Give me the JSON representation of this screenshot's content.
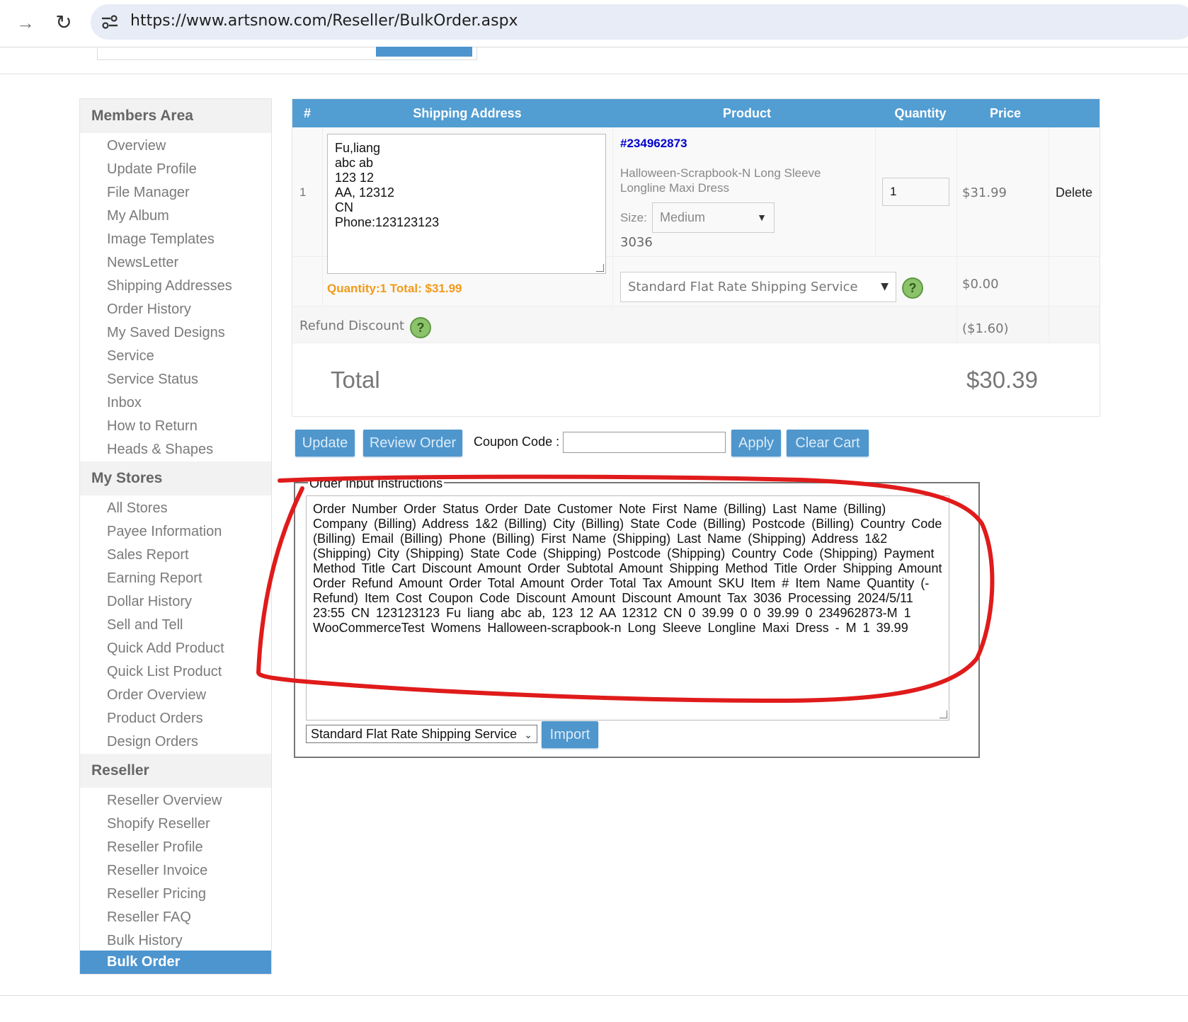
{
  "browser": {
    "url": "https://www.artsnow.com/Reseller/BulkOrder.aspx"
  },
  "sidebar": {
    "sections": [
      {
        "title": "Members Area",
        "items": [
          "Overview",
          "Update Profile",
          "File Manager",
          "My Album",
          "Image Templates",
          "NewsLetter",
          "Shipping Addresses",
          "Order History",
          "My Saved Designs",
          "Service",
          "Service Status",
          "Inbox",
          "How to Return",
          "Heads & Shapes"
        ]
      },
      {
        "title": "My Stores",
        "items": [
          "All Stores",
          "Payee Information",
          "Sales Report",
          "Earning Report",
          "Dollar History",
          "Sell and Tell",
          "Quick Add Product",
          "Quick List Product",
          "Order Overview",
          "Product Orders",
          "Design Orders"
        ]
      },
      {
        "title": "Reseller",
        "items": [
          "Reseller Overview",
          "Shopify Reseller",
          "Reseller Profile",
          "Reseller Invoice",
          "Reseller Pricing",
          "Reseller FAQ",
          "Bulk History",
          "Bulk Order"
        ]
      }
    ],
    "active_item": "Bulk Order"
  },
  "cart": {
    "headers": {
      "index": "#",
      "shipping_address": "Shipping Address",
      "product": "Product",
      "quantity": "Quantity",
      "price": "Price"
    },
    "row": {
      "index": "1",
      "address": "Fu,liang\nabc ab\n123 12\nAA, 12312\nCN\nPhone:123123123",
      "summary": "Quantity:1  Total: $31.99",
      "sku": "#234962873",
      "product_name": "Halloween-Scrapbook-N Long Sleeve Longline Maxi Dress",
      "size_label": "Size:",
      "size_value": "Medium",
      "code": "3036",
      "quantity": "1",
      "price": "$31.99",
      "delete_label": "Delete",
      "shipping_service": "Standard Flat Rate Shipping Service",
      "shipping_price": "$0.00"
    },
    "refund": {
      "label": "Refund Discount",
      "amount": "($1.60)"
    },
    "total": {
      "label": "Total",
      "value": "$30.39"
    },
    "help_glyph": "?"
  },
  "actions": {
    "update": "Update",
    "review_order": "Review Order",
    "coupon_label": "Coupon Code :",
    "coupon_value": "",
    "apply": "Apply",
    "clear_cart": "Clear Cart"
  },
  "import": {
    "legend": "Order Input Instructions",
    "text": "Order Number Order Status   Order Date      Customer Note       First Name (Billing)  Last Name (Billing)  Company (Billing)   Address 1&2 (Billing)       City (Billing)     State Code (Billing)  Postcode (Billing)     Country Code (Billing)   Email (Billing)   Phone (Billing)  First Name (Shipping)       Last Name (Shipping)       Address 1&2 (Shipping)        City (Shipping)        State Code (Shipping)     Postcode (Shipping)       Country Code (Shipping)  Payment Method Title      Cart Discount Amount      Order Subtotal Amount    Shipping Method Title       Order Shipping Amount      Order Refund Amount      Order Total Amount  Order Total Tax Amount   SKU  Item #       Item Name        Quantity (- Refund)  Item Cost  Coupon Code  Discount Amount       Discount Amount Tax 3036      Processing      2024/5/11 23:55                                                                             CN          123123123 Fu    liang          abc ab, 123 12         AA            12312        CN            0       39.99                    0       0        39.99          0 234962873-M  1       WooCommerceTest Womens Halloween-scrapbook-n Long Sleeve Longline Maxi Dress - M     1       39.99",
    "shipping_select": "Standard Flat Rate Shipping Service",
    "import_button": "Import"
  },
  "colors": {
    "accent": "#529dd2",
    "button": "#4f96cd",
    "summary_orange": "#f29a1a",
    "sku_link": "#0000cc",
    "annotation_red": "#e01b1b"
  }
}
